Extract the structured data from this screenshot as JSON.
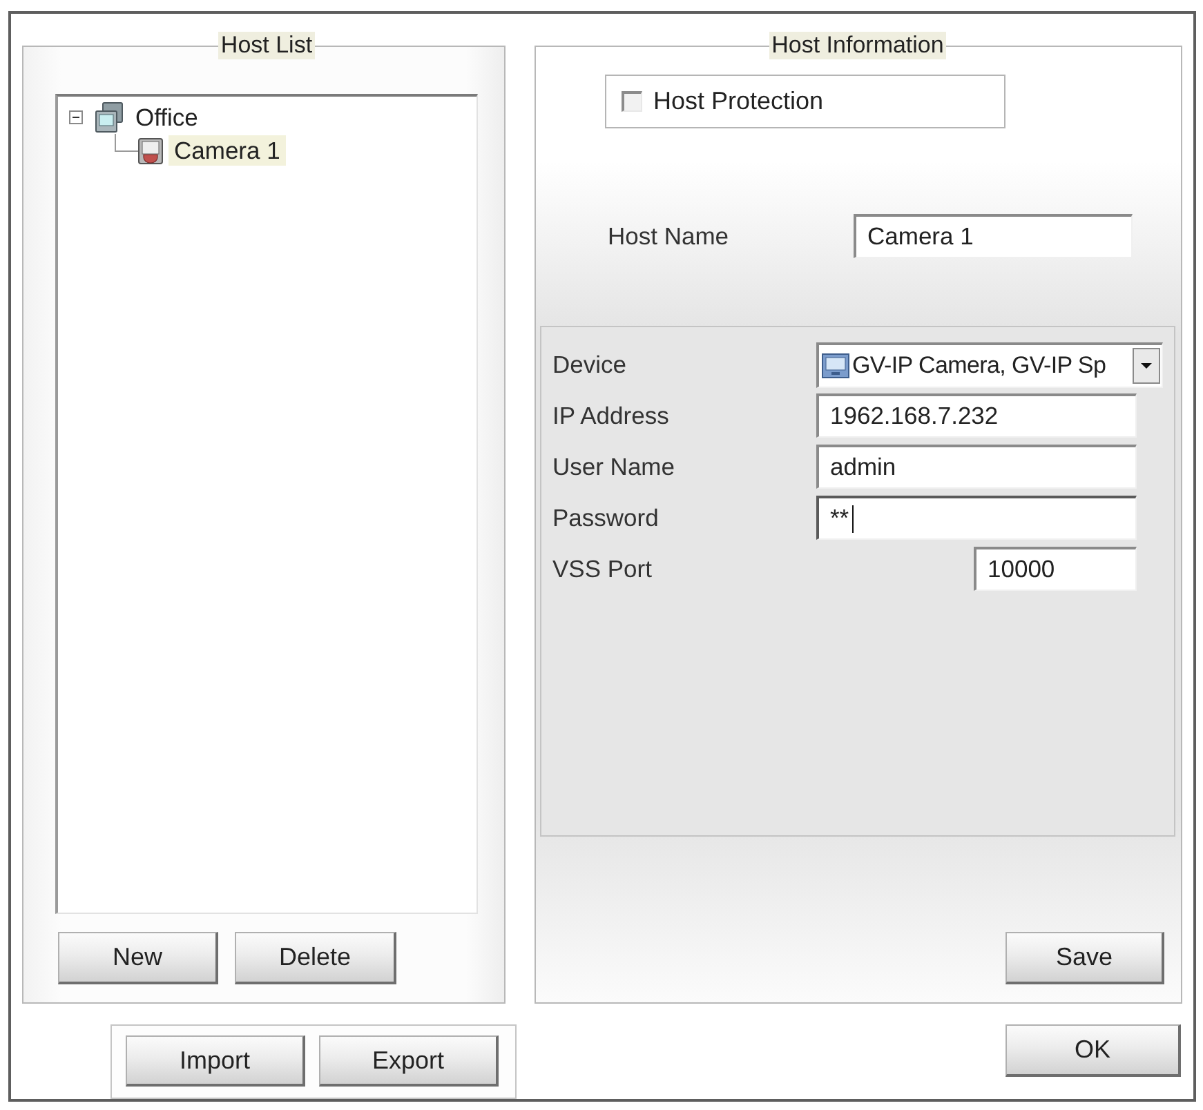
{
  "host_list": {
    "title": "Host List",
    "tree": [
      {
        "label": "Office",
        "expanded": true,
        "selected": false,
        "children": [
          {
            "label": "Camera 1",
            "selected": true
          }
        ]
      }
    ],
    "buttons": [
      "New",
      "Delete"
    ]
  },
  "import_export": {
    "buttons": [
      "Import",
      "Export"
    ]
  },
  "host_information": {
    "title": "Host Information",
    "host_protection": {
      "label": "Host Protection",
      "checked": false
    },
    "host_name": {
      "label": "Host Name",
      "value": "Camera 1"
    },
    "fields": [
      {
        "kind": "select",
        "label": "Device",
        "value": "GV-IP Camera, GV-IP Sp",
        "focused": false
      },
      {
        "kind": "text",
        "label": "IP Address",
        "value": "1962.168.7.232",
        "focused": false
      },
      {
        "kind": "text",
        "label": "User Name",
        "value": "admin",
        "focused": false
      },
      {
        "kind": "text",
        "label": "Password",
        "value": "**",
        "focused": true
      },
      {
        "kind": "number",
        "label": "VSS Port",
        "value": "10000",
        "focused": false
      }
    ],
    "save_button": "Save"
  },
  "ok_button": "OK"
}
